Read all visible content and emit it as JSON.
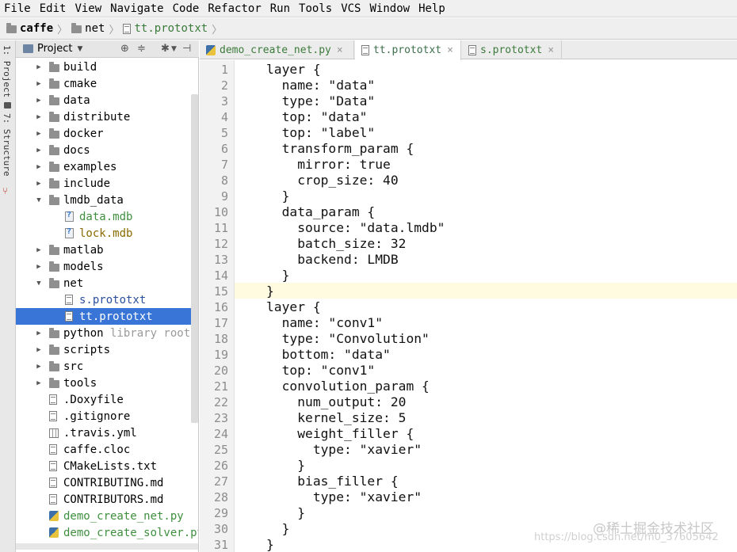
{
  "menu": [
    "File",
    "Edit",
    "View",
    "Navigate",
    "Code",
    "Refactor",
    "Run",
    "Tools",
    "VCS",
    "Window",
    "Help"
  ],
  "breadcrumb": [
    {
      "label": "caffe",
      "icon": "folder-icon"
    },
    {
      "label": "net",
      "icon": "folder-icon"
    },
    {
      "label": "tt.prototxt",
      "icon": "file-icon"
    }
  ],
  "left_toolwindow": {
    "tab1": "1: Project",
    "tab2": "7: Structure"
  },
  "project_panel": {
    "title": "Project"
  },
  "tree": [
    {
      "label": "build",
      "type": "folder",
      "expanded": false,
      "depth": 0
    },
    {
      "label": "cmake",
      "type": "folder",
      "expanded": false,
      "depth": 0
    },
    {
      "label": "data",
      "type": "folder",
      "expanded": false,
      "depth": 0
    },
    {
      "label": "distribute",
      "type": "folder",
      "expanded": false,
      "depth": 0
    },
    {
      "label": "docker",
      "type": "folder",
      "expanded": false,
      "depth": 0
    },
    {
      "label": "docs",
      "type": "folder",
      "expanded": false,
      "depth": 0
    },
    {
      "label": "examples",
      "type": "folder",
      "expanded": false,
      "depth": 0
    },
    {
      "label": "include",
      "type": "folder",
      "expanded": false,
      "depth": 0
    },
    {
      "label": "lmdb_data",
      "type": "folder",
      "expanded": true,
      "depth": 0
    },
    {
      "label": "data.mdb",
      "type": "mdb",
      "depth": 1,
      "color": "green"
    },
    {
      "label": "lock.mdb",
      "type": "mdb",
      "depth": 1,
      "color": "olive"
    },
    {
      "label": "matlab",
      "type": "folder",
      "expanded": false,
      "depth": 0
    },
    {
      "label": "models",
      "type": "folder",
      "expanded": false,
      "depth": 0
    },
    {
      "label": "net",
      "type": "folder",
      "expanded": true,
      "depth": 0
    },
    {
      "label": "s.prototxt",
      "type": "file",
      "depth": 1,
      "color": "blue"
    },
    {
      "label": "tt.prototxt",
      "type": "file",
      "depth": 1,
      "selected": true
    },
    {
      "label": "python",
      "type": "folder",
      "expanded": false,
      "depth": 0,
      "hint": "library root"
    },
    {
      "label": "scripts",
      "type": "folder",
      "expanded": false,
      "depth": 0
    },
    {
      "label": "src",
      "type": "folder",
      "expanded": false,
      "depth": 0
    },
    {
      "label": "tools",
      "type": "folder",
      "expanded": false,
      "depth": 0
    },
    {
      "label": ".Doxyfile",
      "type": "file",
      "depth": 0
    },
    {
      "label": ".gitignore",
      "type": "file",
      "depth": 0
    },
    {
      "label": ".travis.yml",
      "type": "grid",
      "depth": 0
    },
    {
      "label": "caffe.cloc",
      "type": "file",
      "depth": 0
    },
    {
      "label": "CMakeLists.txt",
      "type": "file",
      "depth": 0
    },
    {
      "label": "CONTRIBUTING.md",
      "type": "file",
      "depth": 0
    },
    {
      "label": "CONTRIBUTORS.md",
      "type": "file",
      "depth": 0
    },
    {
      "label": "demo_create_net.py",
      "type": "py",
      "depth": 0,
      "color": "green"
    },
    {
      "label": "demo_create_solver.py",
      "type": "py",
      "depth": 0,
      "color": "green"
    }
  ],
  "tabs": [
    {
      "label": "demo_create_net.py",
      "icon": "python-file-icon",
      "active": false
    },
    {
      "label": "tt.prototxt",
      "icon": "file-icon",
      "active": true
    },
    {
      "label": "s.prototxt",
      "icon": "file-icon",
      "active": false
    }
  ],
  "editor": {
    "current_line": 15,
    "lines": [
      "layer {",
      "  name: \"data\"",
      "  type: \"Data\"",
      "  top: \"data\"",
      "  top: \"label\"",
      "  transform_param {",
      "    mirror: true",
      "    crop_size: 40",
      "  }",
      "  data_param {",
      "    source: \"data.lmdb\"",
      "    batch_size: 32",
      "    backend: LMDB",
      "  }",
      "}",
      "layer {",
      "  name: \"conv1\"",
      "  type: \"Convolution\"",
      "  bottom: \"data\"",
      "  top: \"conv1\"",
      "  convolution_param {",
      "    num_output: 20",
      "    kernel_size: 5",
      "    weight_filler {",
      "      type: \"xavier\"",
      "    }",
      "    bias_filler {",
      "      type: \"xavier\"",
      "    }",
      "  }",
      "}"
    ]
  },
  "watermark": {
    "text": "@稀土掘金技术社区",
    "url": "https://blog.csdn.net/m0_37605642"
  }
}
